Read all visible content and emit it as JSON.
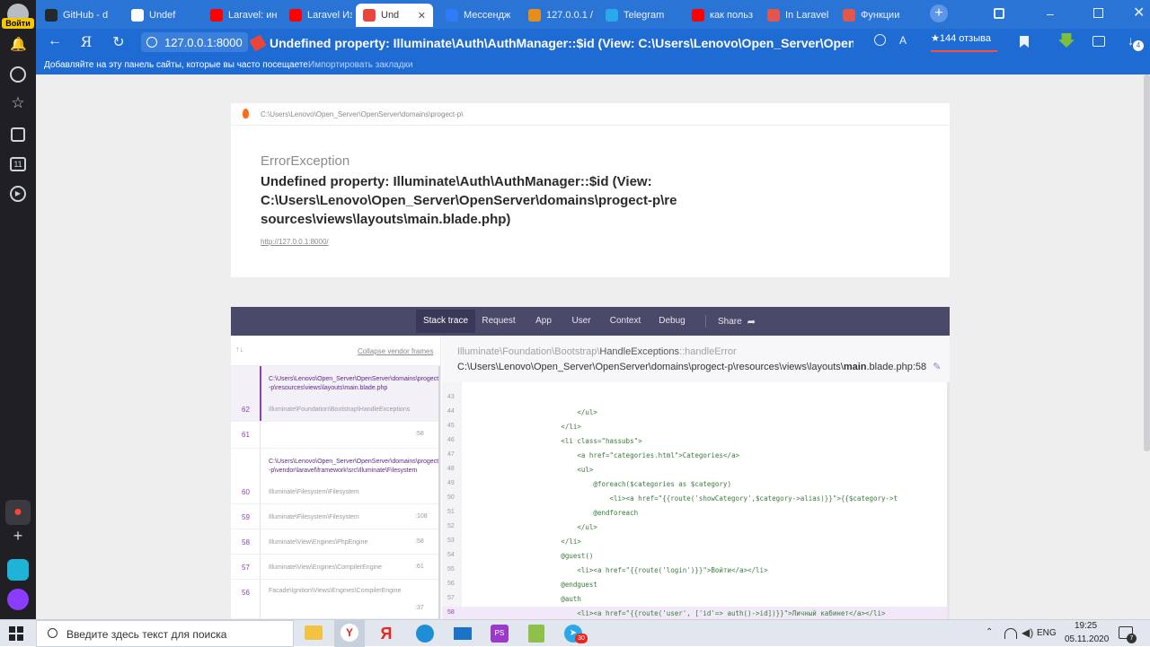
{
  "browser": {
    "leftbar_login": "Войти",
    "tabs": [
      {
        "label": "GitHub - d",
        "icon": "github-icon",
        "color": "#24292e"
      },
      {
        "label": "Undef",
        "icon": "doc-icon",
        "color": "#ffffff"
      },
      {
        "label": "Laravel: ин",
        "icon": "youtube-icon",
        "color": "#ff0000"
      },
      {
        "label": "Laravel Из",
        "icon": "youtube-icon",
        "color": "#ff0000"
      },
      {
        "label": "Und",
        "icon": "ignition-icon",
        "color": "#ffffff",
        "active": true
      },
      {
        "label": "Мессендж",
        "icon": "messenger-icon",
        "color": "#2f7df6"
      },
      {
        "label": "127.0.0.1 /",
        "icon": "pma-icon",
        "color": "#e58e1a"
      },
      {
        "label": "Telegram",
        "icon": "telegram-icon",
        "color": "#29a9eb"
      },
      {
        "label": "как польз",
        "icon": "yandex-icon",
        "color": "#ff0000"
      },
      {
        "label": "In Laravel",
        "icon": "laracasts-icon",
        "color": "#e2574c"
      },
      {
        "label": "Функции",
        "icon": "site-icon",
        "color": "#e2574c"
      }
    ],
    "address": {
      "host": "127.0.0.1:8000",
      "title": "Undefined property: Illuminate\\Auth\\AuthManager::$id (View: C:\\Users\\Lenovo\\Open_Server\\OpenServer\\d..."
    },
    "reviews": "★144 отзыва",
    "download_badge": "4",
    "bookmarks_hint": "Добавляйте на эту панель сайты, которые вы часто посещаете.",
    "bookmarks_import": "Импортировать закладки"
  },
  "error": {
    "path": "C:\\Users\\Lenovo\\Open_Server\\OpenServer\\domains\\progect-p\\",
    "type": "ErrorException",
    "message": "Undefined property: Illuminate\\Auth\\AuthManager::$id (View: C:\\Users\\Lenovo\\Open_Server\\OpenServer\\domains\\progect-p\\resources\\views\\layouts\\main.blade.php)",
    "url": "http://127.0.0.1:8000/"
  },
  "nav": [
    "Stack trace",
    "Request",
    "App",
    "User",
    "Context",
    "Debug"
  ],
  "nav_share": "Share",
  "frames": {
    "collapse_label": "Collapse vendor frames",
    "items": [
      {
        "num": "",
        "file": "C:\\Users\\Lenovo\\Open_Server\\OpenServer\\domains\\progect-p\\resources\\views\\layouts\\main.blade.php",
        "cls": "Illuminate\\Foundation\\Bootstrap\\HandleExceptions",
        "line": "",
        "active": true,
        "num2": "62"
      },
      {
        "num": "61",
        "file": "",
        "cls": "",
        "line": ":58"
      },
      {
        "num": "",
        "file": "C:\\Users\\Lenovo\\Open_Server\\OpenServer\\domains\\progect-p\\vendor\\laravel\\framework\\src\\Illuminate\\Filesystem",
        "cls": "Illuminate\\Filesystem\\Filesystem",
        "line": "",
        "num2": "60"
      },
      {
        "num": "59",
        "file": "",
        "cls": "Illuminate\\Filesystem\\Filesystem",
        "line": ":108"
      },
      {
        "num": "58",
        "file": "",
        "cls": "Illuminate\\View\\Engines\\PhpEngine",
        "line": ":58"
      },
      {
        "num": "57",
        "file": "",
        "cls": "Illuminate\\View\\Engines\\CompilerEngine",
        "line": ":61"
      },
      {
        "num": "56",
        "file": "",
        "cls": "Facade\\Ignition\\Views\\Engines\\CompilerEngine",
        "line": ":37"
      }
    ]
  },
  "detail": {
    "class": "Illuminate\\Foundation\\Bootstrap\\",
    "class_bold": "HandleExceptions",
    "method": "::handleError",
    "file_prefix": "C:\\Users\\Lenovo\\Open_Server\\OpenServer\\domains\\progect-p\\resources\\views\\layouts\\",
    "file_bold": "main",
    "file_suffix": ".blade.php:58"
  },
  "code": [
    {
      "n": "43",
      "t": ""
    },
    {
      "n": "44",
      "t": "                        </ul>"
    },
    {
      "n": "45",
      "t": "                    </li>"
    },
    {
      "n": "46",
      "t": "                    <li class=\"hassubs\">"
    },
    {
      "n": "47",
      "t": "                        <a href=\"categories.html\">Categories</a>"
    },
    {
      "n": "48",
      "t": "                        <ul>"
    },
    {
      "n": "49",
      "t": "                            @foreach($categories as $category)"
    },
    {
      "n": "50",
      "t": "                                <li><a href=\"{{route('showCategory',$category->alias)}}\">{{$category->t"
    },
    {
      "n": "51",
      "t": "                            @endforeach"
    },
    {
      "n": "52",
      "t": "                        </ul>"
    },
    {
      "n": "53",
      "t": "                    </li>"
    },
    {
      "n": "54",
      "t": "                    @guest()"
    },
    {
      "n": "55",
      "t": "                        <li><a href=\"{{route('login')}}\">Войти</a></li>"
    },
    {
      "n": "56",
      "t": "                    @endguest"
    },
    {
      "n": "57",
      "t": "                    @auth"
    },
    {
      "n": "58",
      "t": "                        <li><a href=\"{{route('user', ['id'=> auth()->id])}}\">Личный кабинет</a></li>",
      "hl": true
    }
  ],
  "taskbar": {
    "search": "Введите здесь текст для поиска",
    "lang": "ENG",
    "time": "19:25",
    "date": "05.11.2020",
    "notif": "7",
    "telegram_badge": "30"
  }
}
